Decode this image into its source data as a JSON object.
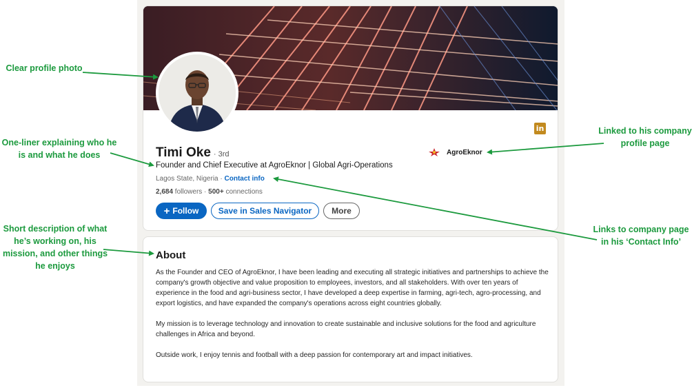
{
  "profile": {
    "name": "Timi Oke",
    "degree": "· 3rd",
    "headline": "Founder and Chief Executive at AgroEknor | Global Agri-Operations",
    "location": "Lagos State, Nigeria",
    "separator": " · ",
    "contact_info_label": "Contact info",
    "followers": "2,684",
    "followers_label": " followers",
    "connections_sep": " · ",
    "connections": "500+",
    "connections_label": " connections",
    "linkedin_badge": "in",
    "company_name": "AgroEknor"
  },
  "actions": {
    "follow_plus": "+",
    "follow_label": "Follow",
    "sales_navigator_label": "Save in Sales Navigator",
    "more_label": "More"
  },
  "about": {
    "title": "About",
    "paragraphs": [
      "As the Founder and CEO of AgroEknor, I have been leading and executing all strategic initiatives and partnerships to achieve the company's growth objective and value proposition to employees, investors, and all stakeholders. With over ten years of experience in the food and agri-business sector, I have developed a deep expertise in farming, agri-tech, agro-processing, and export logistics, and have expanded the company's operations across eight countries globally.",
      "My mission is to leverage technology and innovation to create sustainable and inclusive solutions for the food and agriculture challenges in Africa and beyond.",
      "Outside work, I enjoy tennis and football with a deep passion for contemporary art and impact initiatives."
    ]
  },
  "annotations": {
    "photo": "Clear profile photo",
    "oneliner": "One-liner explaining who he is and what he does",
    "description": "Short description of what he’s working on, his mission, and other things he enjoys",
    "company_link": "Linked to his company profile page",
    "contact_link": "Links to company page in his ‘Contact Info’"
  },
  "colors": {
    "accent": "#0a66c2",
    "annotation_green": "#1c9a3e",
    "linkedin_badge": "#c28a1f",
    "page_background": "#f3f2ef"
  },
  "icons": [
    "linkedin-icon",
    "plus-icon",
    "company-logo-icon"
  ]
}
